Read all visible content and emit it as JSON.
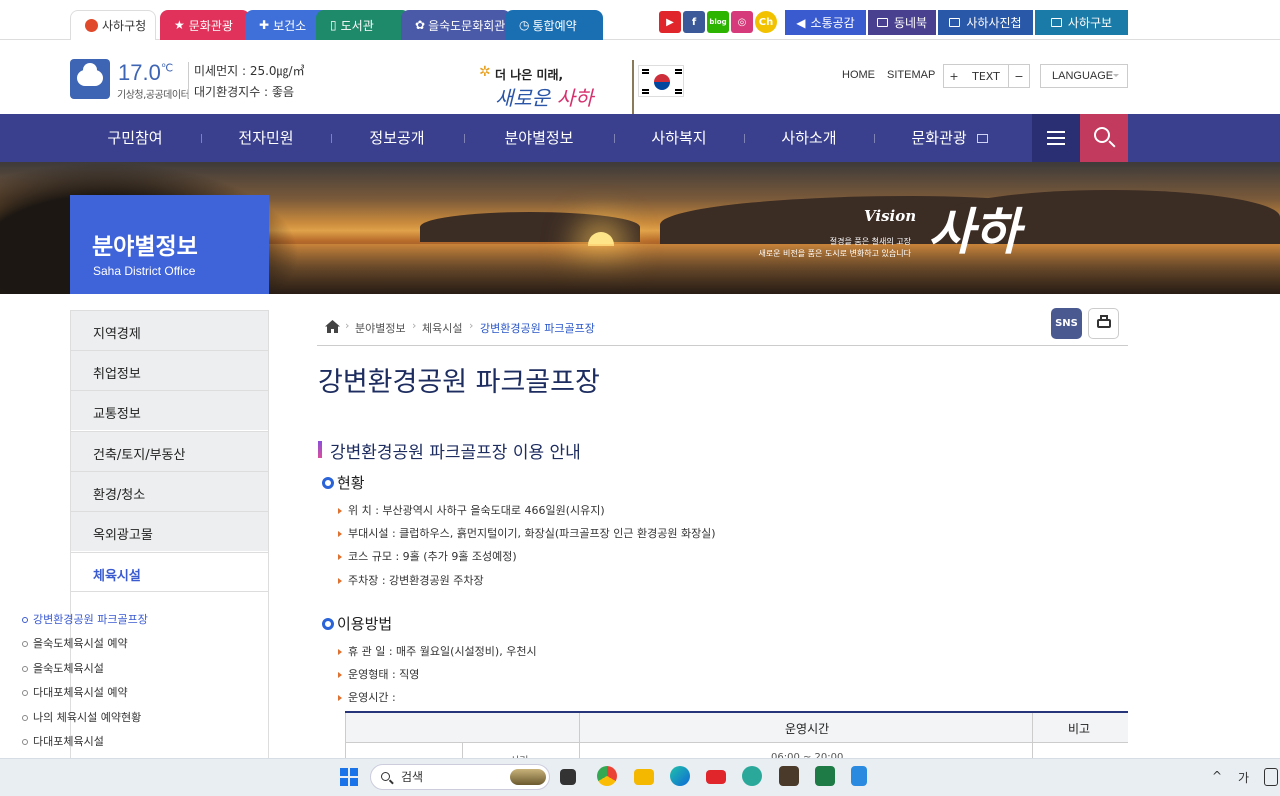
{
  "top_tabs": [
    {
      "label": "사하구청",
      "color": "#ffffff"
    },
    {
      "label": "문화관광",
      "color": "#e0325a"
    },
    {
      "label": "보건소",
      "color": "#3f6fd8"
    },
    {
      "label": "도서관",
      "color": "#1e8a6a"
    },
    {
      "label": "을숙도문화회관",
      "color": "#4a5aa8"
    },
    {
      "label": "통합예약",
      "color": "#1a6fb3"
    }
  ],
  "sns_icons": [
    {
      "name": "youtube-icon",
      "glyph": "▶",
      "color": "#e0262b"
    },
    {
      "name": "facebook-icon",
      "glyph": "f",
      "color": "#3b5998"
    },
    {
      "name": "blog-icon",
      "glyph": "blog",
      "color": "#2db400"
    },
    {
      "name": "instagram-icon",
      "glyph": "◎",
      "color": "#d63a7a"
    },
    {
      "name": "kakao-channel-icon",
      "glyph": "Ch",
      "color": "#f2c200"
    }
  ],
  "util_buttons": [
    {
      "label": "소통공감",
      "color": "#3a5ad0"
    },
    {
      "label": "동네북",
      "color": "#4a4090"
    },
    {
      "label": "사하사진첩",
      "color": "#2a58a8"
    },
    {
      "label": "사하구보",
      "color": "#1a7aa8"
    }
  ],
  "weather": {
    "temperature": "17.0",
    "unit": "℃",
    "source": "기상청,공공데이터",
    "fine_dust": "미세먼지 : 25.0㎍/㎥",
    "air_index": "대기환경지수 : 좋음"
  },
  "logo": {
    "line1": "더 나은 미래,",
    "line2a": "새로운",
    "line2b": "사하"
  },
  "header_links": {
    "home": "HOME",
    "sitemap": "SITEMAP",
    "text_plus": "+",
    "text": "TEXT",
    "text_minus": "−",
    "language": "LANGUAGE"
  },
  "gnb": [
    "구민참여",
    "전자민원",
    "정보공개",
    "분야별정보",
    "사하복지",
    "사하소개",
    "문화관광"
  ],
  "visual": {
    "title": "분야별정보",
    "subtitle": "Saha District Office",
    "vision": "Vision",
    "slogan1": "절경을 품은 철새의 고장",
    "slogan2": "새로운 비전을 품은 도시로 변화하고 있습니다",
    "saha": "사하"
  },
  "lnb": [
    "지역경제",
    "취업정보",
    "교통정보",
    "건축/토지/부동산",
    "환경/청소",
    "옥외광고물",
    "체육시설"
  ],
  "lnb_sub": [
    "강변환경공원 파크골프장",
    "을숙도체육시설 예약",
    "을숙도체육시설",
    "다대포체육시설 예약",
    "나의 체육시설 예약현황",
    "다대포체육시설"
  ],
  "breadcrumb": [
    "분야별정보",
    "체육시설",
    "강변환경공원 파크골프장"
  ],
  "sns_button": "SNS",
  "content": {
    "page_title": "강변환경공원 파크골프장",
    "section_title": "강변환경공원 파크골프장 이용 안내",
    "status_heading": "현황",
    "status_items": [
      "위 치 : 부산광역시 사하구 을숙도대로 466일원(시유지)",
      "부대시설 : 클럽하우스, 흙먼지털이기, 화장실(파크골프장 인근 환경공원 화장실)",
      "코스 규모 : 9홀 (추가 9홀 조성예정)",
      "주차장 : 강변환경공원 주차장"
    ],
    "usage_heading": "이용방법",
    "usage_items": [
      "휴 관 일 : 매주 월요일(시설정비), 우천시",
      "운영형태 : 직영",
      "운영시간 :"
    ],
    "table": {
      "headers": [
        "운영시간",
        "비고"
      ],
      "row1_col2": "시기",
      "row1_col3": "06:00 ~ 20:00"
    }
  },
  "taskbar": {
    "search_placeholder": "검색",
    "ime": "가",
    "tray_arrow": "^"
  }
}
